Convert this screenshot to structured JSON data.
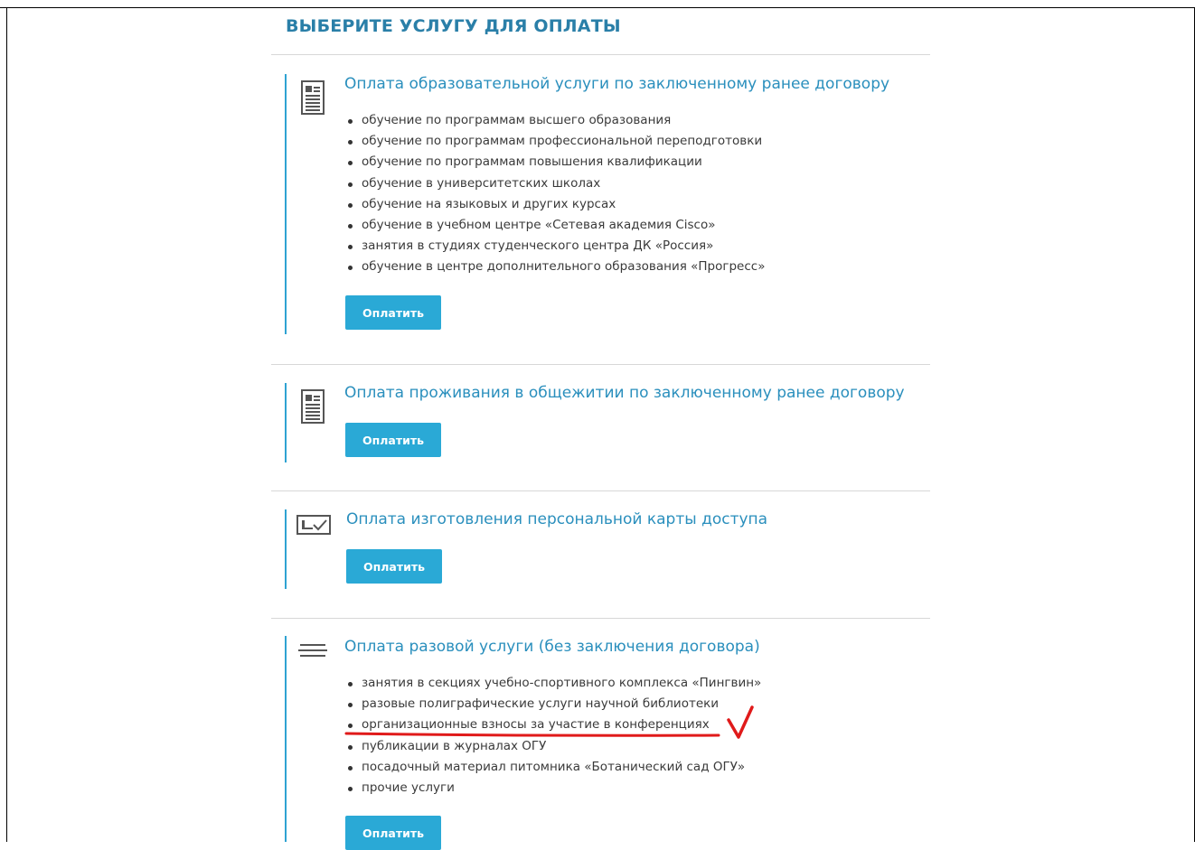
{
  "page": {
    "title": "ВЫБЕРИТЕ УСЛУГУ ДЛЯ ОПЛАТЫ"
  },
  "sections": [
    {
      "icon": "document-icon",
      "title": "Оплата образовательной услуги по заключенному ранее договору",
      "items": [
        "обучение по программам высшего образования",
        "обучение по программам профессиональной переподготовки",
        "обучение по программам повышения квалификации",
        "обучение в университетских школах",
        "обучение на языковых и других курсах",
        "обучение в учебном центре «Сетевая академия Cisco»",
        "занятия в студиях студенческого центра ДК «Россия»",
        "обучение в центре дополнительного образования «Прогресс»"
      ],
      "button_label": "Оплатить"
    },
    {
      "icon": "document-icon",
      "title": "Оплата проживания в общежитии по заключенному ранее договору",
      "items": [],
      "button_label": "Оплатить"
    },
    {
      "icon": "access-card-icon",
      "title": "Оплата изготовления персональной карты доступа",
      "items": [],
      "button_label": "Оплатить"
    },
    {
      "icon": "list-lines-icon",
      "title": "Оплата разовой услуги (без заключения договора)",
      "items": [
        "занятия в секциях учебно-спортивного комплекса «Пингвин»",
        "разовые полиграфические услуги научной библиотеки",
        "организационные взносы за участие в конференциях",
        "публикации в журналах ОГУ",
        "посадочный материал питомника «Ботанический сад ОГУ»",
        "прочие услуги"
      ],
      "button_label": "Оплатить"
    }
  ],
  "colors": {
    "accent": "#2aa9d6",
    "title": "#2a7fa8",
    "annotation": "#e01a1a"
  }
}
